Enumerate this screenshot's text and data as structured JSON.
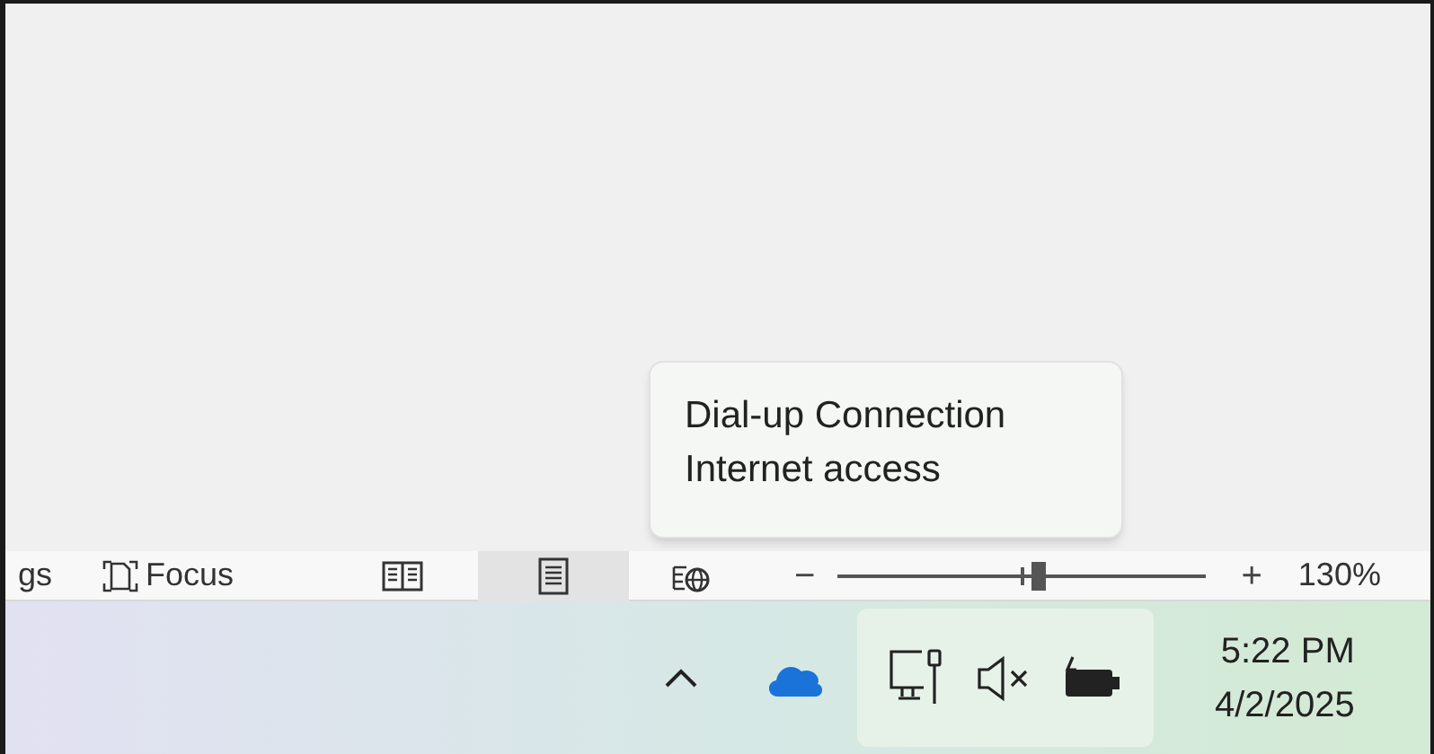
{
  "status_bar": {
    "items": [
      {
        "kind": "text",
        "label": "gs"
      },
      {
        "kind": "focus",
        "label": "Focus"
      },
      {
        "kind": "read_mode",
        "selected": false
      },
      {
        "kind": "print_layout",
        "selected": true
      },
      {
        "kind": "web_layout",
        "selected": false
      }
    ],
    "zoom": {
      "minus": "−",
      "level": 0.55,
      "plus": "+",
      "reading": "130%"
    }
  },
  "tooltip": {
    "lines": [
      "Dial-up Connection",
      "Internet access"
    ]
  },
  "taskbar": {
    "tray": {
      "volume_muted": true
    },
    "clock": {
      "time": "5:22 PM",
      "date": "4/2/2025"
    }
  }
}
